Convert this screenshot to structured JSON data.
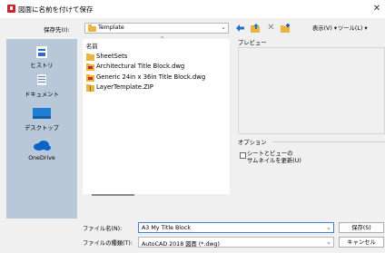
{
  "window": {
    "title": "図面に名前を付けて保存",
    "close": "✕"
  },
  "toolbar": {
    "save_in_label": "保存先(I):",
    "save_in_value": "Template",
    "views_label": "表示(V)",
    "tools_label": "ツール(L)",
    "dropdown_glyph": "⌄",
    "menu_arrow": "▾"
  },
  "places": [
    {
      "label": "ヒストリ"
    },
    {
      "label": "ドキュメント"
    },
    {
      "label": "デスクトップ"
    },
    {
      "label": "OneDrive"
    }
  ],
  "file_list": {
    "column_header": "名前",
    "sort_glyph": "^",
    "items": [
      {
        "name": "SheetSets",
        "type": "folder"
      },
      {
        "name": "Architectural Title Block.dwg",
        "type": "dwg"
      },
      {
        "name": "Generic 24in x 36in Title Block.dwg",
        "type": "dwg"
      },
      {
        "name": "LayerTemplate.ZIP",
        "type": "zip"
      }
    ]
  },
  "preview": {
    "label": "プレビュー"
  },
  "options": {
    "label": "オプション",
    "update_thumbnail_line1": "シートとビューの",
    "update_thumbnail_line2": "サムネイルを更新(U)",
    "update_thumbnail_checked": false
  },
  "bottom": {
    "file_name_label": "ファイル名(N):",
    "file_name_value": "A3 My Title Block",
    "file_type_label": "ファイルの種類(T):",
    "file_type_value": "AutoCAD 2018 図面 (*.dwg)",
    "save_button": "保存(S)",
    "cancel_button": "キャンセル"
  },
  "colors": {
    "sidebar": "#b9c8d9",
    "folder": "#e9b53f",
    "accent": "#2b6cc4",
    "title_icon": "#c8262b"
  }
}
